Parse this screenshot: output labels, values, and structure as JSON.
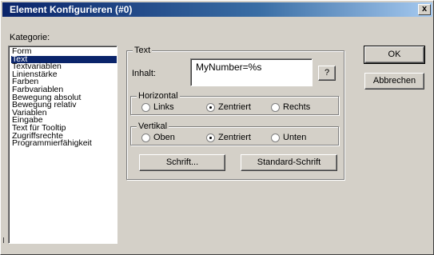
{
  "window": {
    "title": "Element Konfigurieren (#0)",
    "close_glyph": "x"
  },
  "kategorie": {
    "label": "Kategorie:",
    "items": [
      "Form",
      "Text",
      "Textvariablen",
      "Linienstärke",
      "Farben",
      "Farbvariablen",
      "Bewegung absolut",
      "Bewegung relativ",
      "Variablen",
      "Eingabe",
      "Text für Tooltip",
      "Zugriffsrechte",
      "Programmierfähigkeit"
    ],
    "selected": "Text"
  },
  "text_group": {
    "title": "Text",
    "inhalt_label": "Inhalt:",
    "inhalt_value": "MyNumber=%s",
    "browse_label": "?"
  },
  "horizontal": {
    "title": "Horizontal",
    "options": [
      "Links",
      "Zentriert",
      "Rechts"
    ],
    "selected": "Zentriert"
  },
  "vertikal": {
    "title": "Vertikal",
    "options": [
      "Oben",
      "Zentriert",
      "Unten"
    ],
    "selected": "Zentriert"
  },
  "buttons": {
    "schrift": "Schrift...",
    "standard_schrift": "Standard-Schrift",
    "ok": "OK",
    "abbrechen": "Abbrechen"
  }
}
